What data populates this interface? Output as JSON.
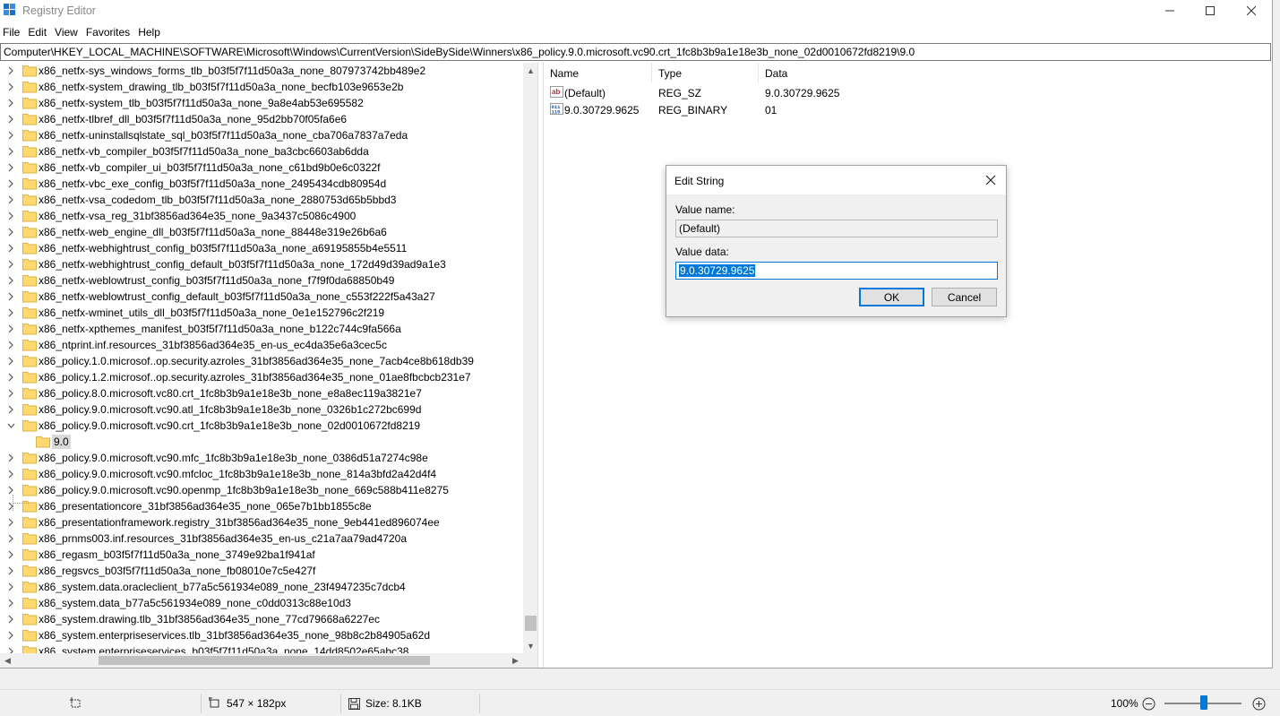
{
  "window": {
    "title": "Registry Editor",
    "min_glyph": "—",
    "max_glyph": "☐",
    "close_glyph": "✕"
  },
  "menu": [
    "File",
    "Edit",
    "View",
    "Favorites",
    "Help"
  ],
  "address": "Computer\\HKEY_LOCAL_MACHINE\\SOFTWARE\\Microsoft\\Windows\\CurrentVersion\\SideBySide\\Winners\\x86_policy.9.0.microsoft.vc90.crt_1fc8b3b9a1e18e3b_none_02d0010672fd8219\\9.0",
  "tree": {
    "items": [
      "x86_netfx-sys_windows_forms_tlb_b03f5f7f11d50a3a_none_807973742bb489e2",
      "x86_netfx-system_drawing_tlb_b03f5f7f11d50a3a_none_becfb103e9653e2b",
      "x86_netfx-system_tlb_b03f5f7f11d50a3a_none_9a8e4ab53e695582",
      "x86_netfx-tlbref_dll_b03f5f7f11d50a3a_none_95d2bb70f05fa6e6",
      "x86_netfx-uninstallsqlstate_sql_b03f5f7f11d50a3a_none_cba706a7837a7eda",
      "x86_netfx-vb_compiler_b03f5f7f11d50a3a_none_ba3cbc6603ab6dda",
      "x86_netfx-vb_compiler_ui_b03f5f7f11d50a3a_none_c61bd9b0e6c0322f",
      "x86_netfx-vbc_exe_config_b03f5f7f11d50a3a_none_2495434cdb80954d",
      "x86_netfx-vsa_codedom_tlb_b03f5f7f11d50a3a_none_2880753d65b5bbd3",
      "x86_netfx-vsa_reg_31bf3856ad364e35_none_9a3437c5086c4900",
      "x86_netfx-web_engine_dll_b03f5f7f11d50a3a_none_88448e319e26b6a6",
      "x86_netfx-webhightrust_config_b03f5f7f11d50a3a_none_a69195855b4e5511",
      "x86_netfx-webhightrust_config_default_b03f5f7f11d50a3a_none_172d49d39ad9a1e3",
      "x86_netfx-weblowtrust_config_b03f5f7f11d50a3a_none_f7f9f0da68850b49",
      "x86_netfx-weblowtrust_config_default_b03f5f7f11d50a3a_none_c553f222f5a43a27",
      "x86_netfx-wminet_utils_dll_b03f5f7f11d50a3a_none_0e1e152796c2f219",
      "x86_netfx-xpthemes_manifest_b03f5f7f11d50a3a_none_b122c744c9fa566a",
      "x86_ntprint.inf.resources_31bf3856ad364e35_en-us_ec4da35e6a3cec5c",
      "x86_policy.1.0.microsof..op.security.azroles_31bf3856ad364e35_none_7acb4ce8b618db39",
      "x86_policy.1.2.microsof..op.security.azroles_31bf3856ad364e35_none_01ae8fbcbcb231e7",
      "x86_policy.8.0.microsoft.vc80.crt_1fc8b3b9a1e18e3b_none_e8a8ec119a3821e7",
      "x86_policy.9.0.microsoft.vc90.atl_1fc8b3b9a1e18e3b_none_0326b1c272bc699d",
      "x86_policy.9.0.microsoft.vc90.crt_1fc8b3b9a1e18e3b_none_02d0010672fd8219"
    ],
    "child": "9.0",
    "items_after": [
      "x86_policy.9.0.microsoft.vc90.mfc_1fc8b3b9a1e18e3b_none_0386d51a7274c98e",
      "x86_policy.9.0.microsoft.vc90.mfcloc_1fc8b3b9a1e18e3b_none_814a3bfd2a42d4f4",
      "x86_policy.9.0.microsoft.vc90.openmp_1fc8b3b9a1e18e3b_none_669c588b411e8275",
      "x86_presentationcore_31bf3856ad364e35_none_065e7b1bb1855c8e",
      "x86_presentationframework.registry_31bf3856ad364e35_none_9eb441ed896074ee",
      "x86_prnms003.inf.resources_31bf3856ad364e35_en-us_c21a7aa79ad4720a",
      "x86_regasm_b03f5f7f11d50a3a_none_3749e92ba1f941af",
      "x86_regsvcs_b03f5f7f11d50a3a_none_fb08010e7c5e427f",
      "x86_system.data.oracleclient_b77a5c561934e089_none_23f4947235c7dcb4",
      "x86_system.data_b77a5c561934e089_none_c0dd0313c88e10d3",
      "x86_system.drawing.tlb_31bf3856ad364e35_none_77cd79668a6227ec",
      "x86_system.enterpriseservices.tlb_31bf3856ad364e35_none_98b8c2b84905a62d",
      "x86_system.enterpriseservices_b03f5f7f11d50a3a_none_14dd8502e65abc38"
    ]
  },
  "values": {
    "columns": {
      "name": "Name",
      "type": "Type",
      "data": "Data"
    },
    "rows": [
      {
        "icon": "string-value-icon",
        "name": "(Default)",
        "type": "REG_SZ",
        "data": "9.0.30729.9625"
      },
      {
        "icon": "binary-value-icon",
        "name": "9.0.30729.9625",
        "type": "REG_BINARY",
        "data": "01"
      }
    ]
  },
  "dialog": {
    "title": "Edit String",
    "value_name_label": "Value name:",
    "value_name": "(Default)",
    "value_data_label": "Value data:",
    "value_data": "9.0.30729.9625",
    "ok": "OK",
    "cancel": "Cancel"
  },
  "statusbar": {
    "dimensions": "547 × 182px",
    "size": "Size: 8.1KB",
    "zoom": "100%"
  },
  "colors": {
    "accent": "#0078d7",
    "folder": "#ffd970",
    "selection_bg": "#d9d9d9"
  }
}
